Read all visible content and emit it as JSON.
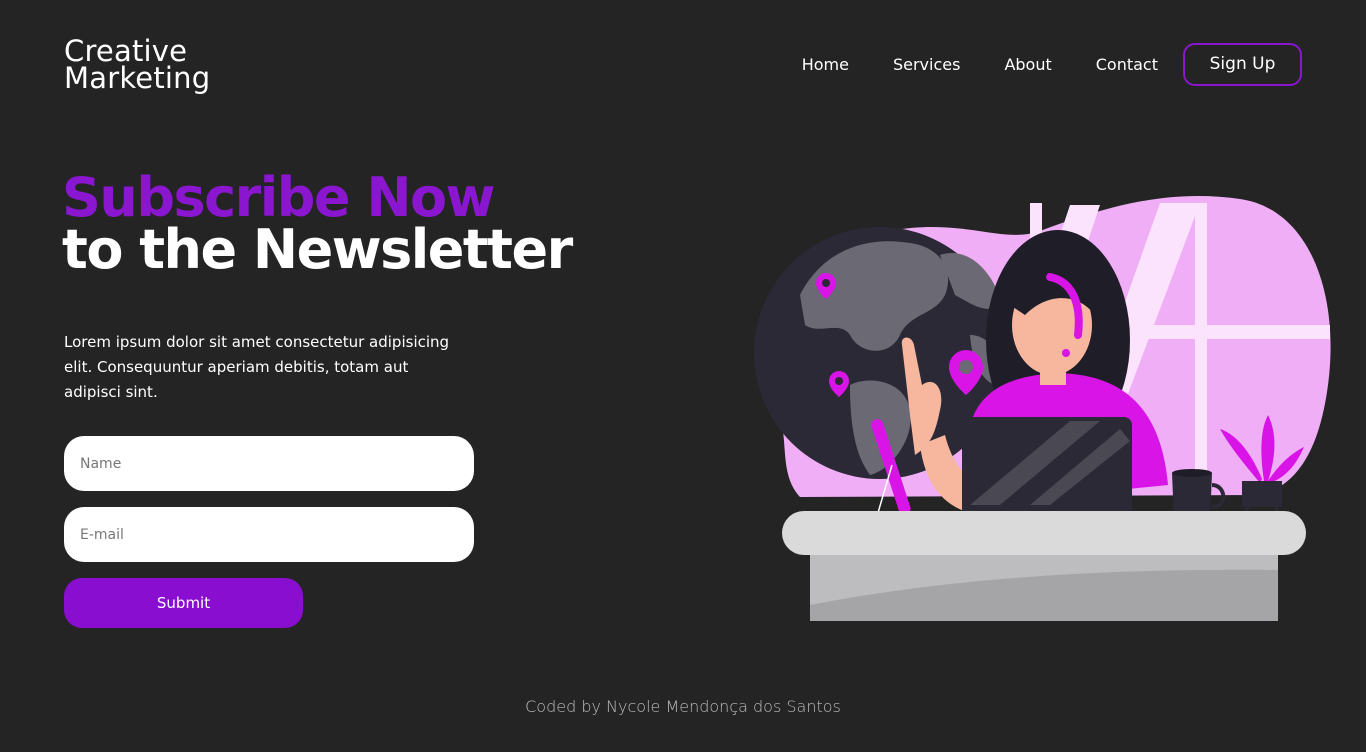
{
  "brand": {
    "line1": "Creative",
    "line2": "Marketing"
  },
  "nav": {
    "items": [
      "Home",
      "Services",
      "About",
      "Contact"
    ],
    "cta": "Sign Up"
  },
  "hero": {
    "title_accent": "Subscribe Now",
    "title_rest": "to the Newsletter",
    "description": "Lorem ipsum dolor sit amet consectetur adipisicing elit. Consequuntur aperiam debitis, totam aut adipisci sint."
  },
  "form": {
    "name_placeholder": "Name",
    "email_placeholder": "E-mail",
    "submit_label": "Submit"
  },
  "footer": {
    "credit": "Coded by Nycole Mendonça dos Santos"
  },
  "colors": {
    "background": "#242424",
    "accent": "#8a16cf",
    "illustration_pink": "#f0aef7",
    "illustration_magenta": "#d814e6"
  },
  "illustration": {
    "description_icon": "person-at-laptop-with-globe"
  }
}
